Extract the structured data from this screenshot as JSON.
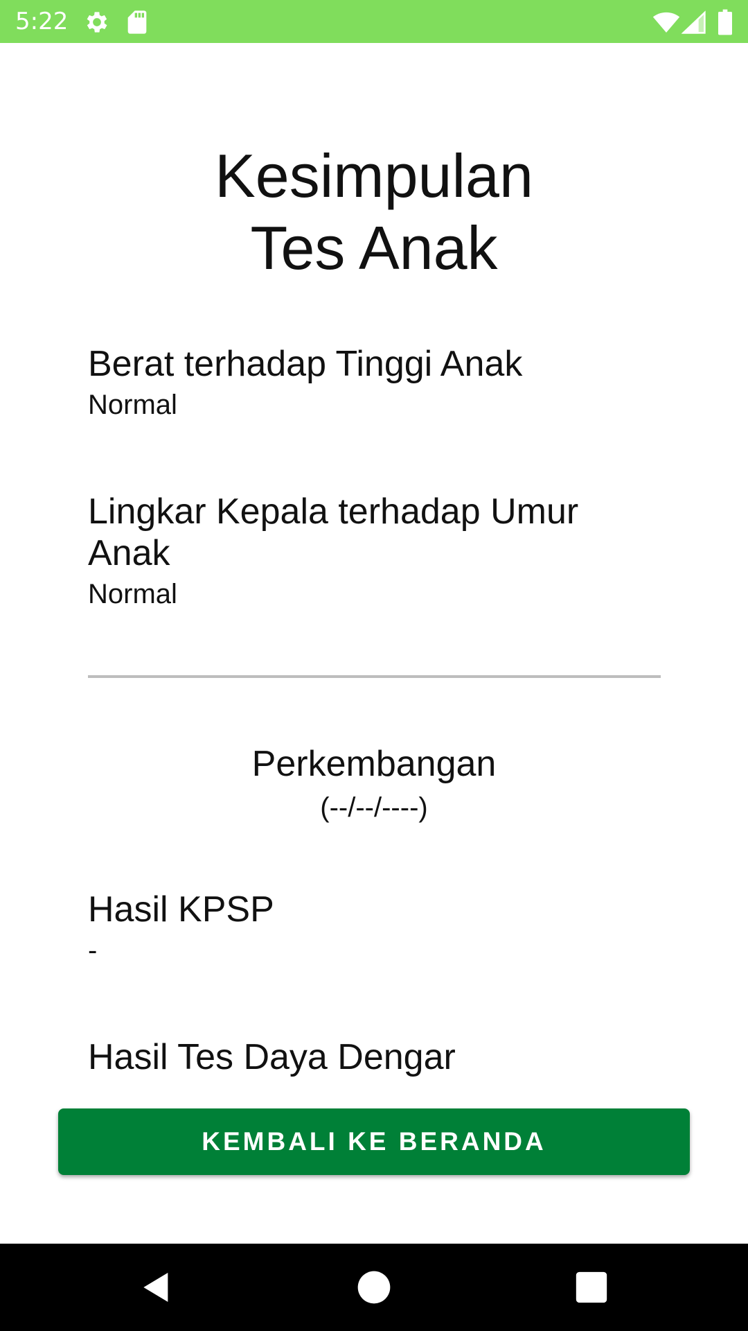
{
  "status_bar": {
    "time": "5:22",
    "background_color": "#80dd5c",
    "left_icons": [
      "settings-gear-icon",
      "sd-card-icon"
    ],
    "right_icons": [
      "wifi-icon",
      "cell-signal-icon",
      "battery-icon"
    ]
  },
  "page": {
    "title_line1": "Kesimpulan",
    "title_line2": "Tes Anak"
  },
  "results": [
    {
      "label": "Berat terhadap Tinggi Anak",
      "value": "Normal"
    },
    {
      "label": "Lingkar Kepala terhadap Umur Anak",
      "value": "Normal"
    }
  ],
  "development": {
    "title": "Perkembangan",
    "date": "(--/--/----)",
    "items": [
      {
        "label": "Hasil KPSP",
        "value": "-"
      },
      {
        "label": "Hasil Tes Daya Dengar",
        "value": ""
      }
    ]
  },
  "primary_button": {
    "label": "KEMBALI KE BERANDA",
    "color": "#008037"
  },
  "nav_bar": {
    "buttons": [
      "back-icon",
      "home-icon",
      "recents-icon"
    ]
  }
}
